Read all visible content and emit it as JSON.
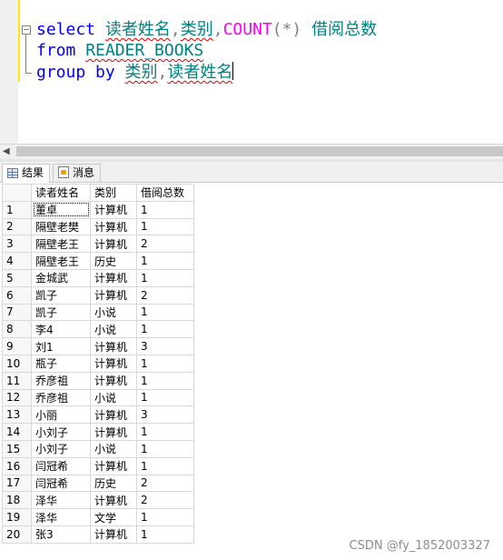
{
  "editor": {
    "line1": {
      "keyword": "select",
      "field1": "读者姓名",
      "comma1": ",",
      "field2": "类别",
      "comma2": ",",
      "func": "COUNT",
      "paren": "(*)",
      "alias": "借阅总数"
    },
    "line2": {
      "keyword": "from",
      "table": "READER_BOOKS"
    },
    "line3": {
      "keyword": "group by",
      "field1": "类别",
      "comma": ",",
      "field2": "读者姓名"
    }
  },
  "tabs": {
    "results_label": "结果",
    "messages_label": "消息"
  },
  "grid": {
    "columns": [
      "读者姓名",
      "类别",
      "借阅总数"
    ],
    "rows": [
      {
        "num": "1",
        "name": "董卓",
        "category": "计算机",
        "count": "1"
      },
      {
        "num": "2",
        "name": "隔壁老樊",
        "category": "计算机",
        "count": "1"
      },
      {
        "num": "3",
        "name": "隔壁老王",
        "category": "计算机",
        "count": "2"
      },
      {
        "num": "4",
        "name": "隔壁老王",
        "category": "历史",
        "count": "1"
      },
      {
        "num": "5",
        "name": "金城武",
        "category": "计算机",
        "count": "1"
      },
      {
        "num": "6",
        "name": "凯子",
        "category": "计算机",
        "count": "2"
      },
      {
        "num": "7",
        "name": "凯子",
        "category": "小说",
        "count": "1"
      },
      {
        "num": "8",
        "name": "李4",
        "category": "小说",
        "count": "1"
      },
      {
        "num": "9",
        "name": "刘1",
        "category": "计算机",
        "count": "3"
      },
      {
        "num": "10",
        "name": "瓶子",
        "category": "计算机",
        "count": "1"
      },
      {
        "num": "11",
        "name": "乔彦祖",
        "category": "计算机",
        "count": "1"
      },
      {
        "num": "12",
        "name": "乔彦祖",
        "category": "小说",
        "count": "1"
      },
      {
        "num": "13",
        "name": "小丽",
        "category": "计算机",
        "count": "3"
      },
      {
        "num": "14",
        "name": "小刘子",
        "category": "计算机",
        "count": "1"
      },
      {
        "num": "15",
        "name": "小刘子",
        "category": "小说",
        "count": "1"
      },
      {
        "num": "16",
        "name": "闫冠希",
        "category": "计算机",
        "count": "1"
      },
      {
        "num": "17",
        "name": "闫冠希",
        "category": "历史",
        "count": "2"
      },
      {
        "num": "18",
        "name": "泽华",
        "category": "计算机",
        "count": "2"
      },
      {
        "num": "19",
        "name": "泽华",
        "category": "文学",
        "count": "1"
      },
      {
        "num": "20",
        "name": "张3",
        "category": "计算机",
        "count": "1"
      }
    ]
  },
  "watermark": "CSDN @fy_1852003327",
  "colors": {
    "keyword": "#0000ff",
    "identifier": "#008080",
    "function": "#ff00ff",
    "operator": "#808080"
  }
}
